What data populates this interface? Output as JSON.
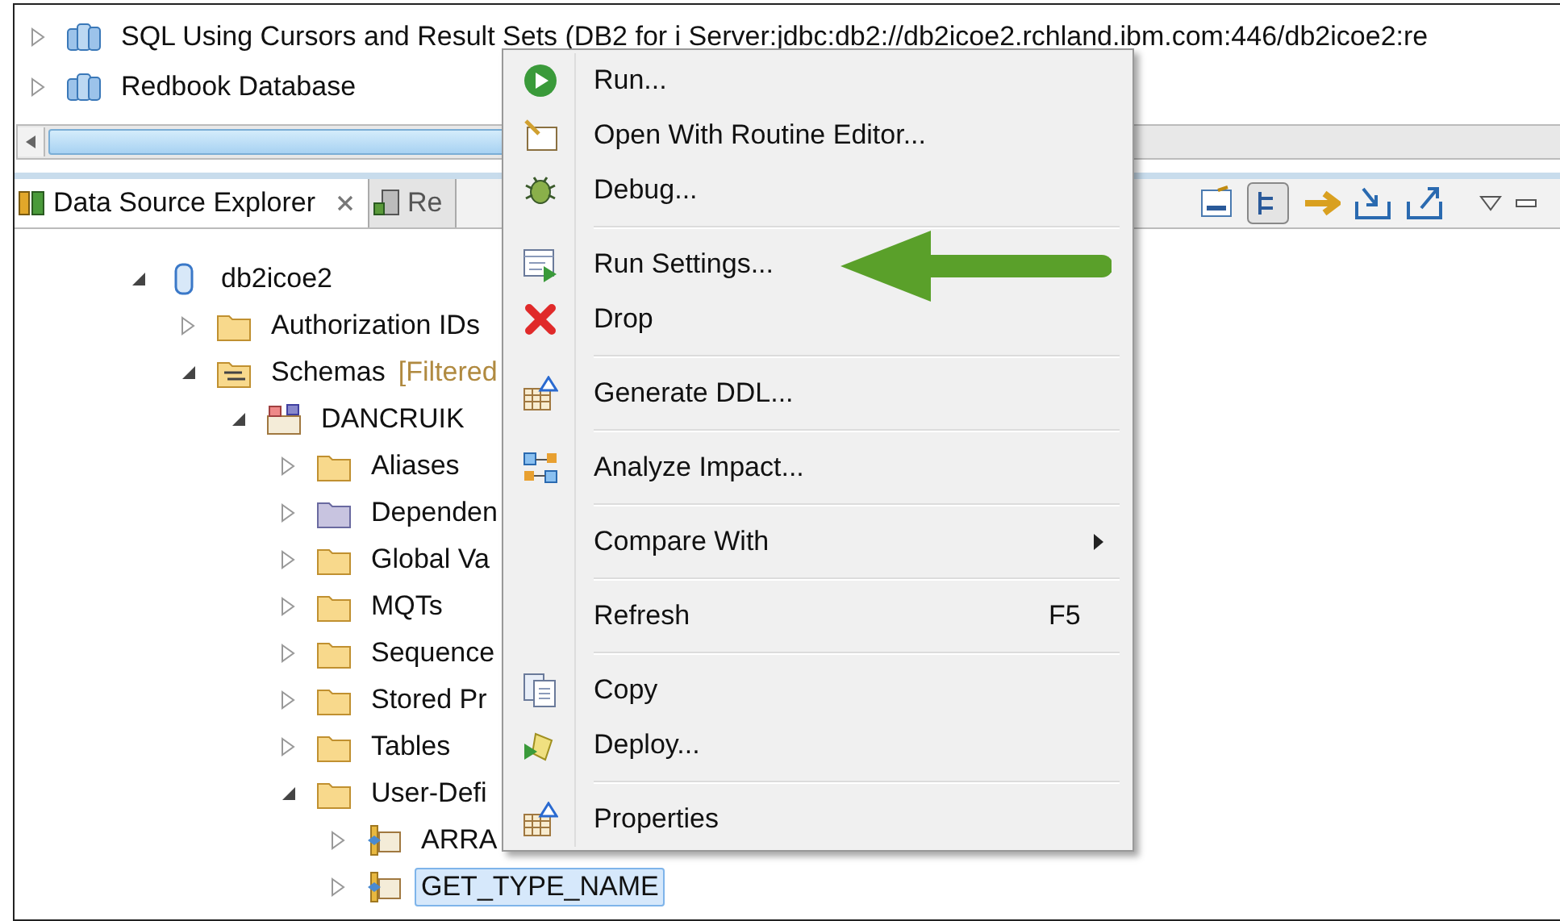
{
  "top_tree": [
    {
      "kind": "database-group",
      "label": "SQL Using Cursors and Result Sets (DB2 for i Server:jdbc:db2://db2icoe2.rchland.ibm.com:446/db2icoe2:re",
      "expanded": false
    },
    {
      "kind": "database-group",
      "label": "Redbook Database",
      "expanded": false
    }
  ],
  "tabs": [
    {
      "label": "Data Source Explorer",
      "selected": true,
      "closable": true
    },
    {
      "label": "Re",
      "selected": false,
      "closable": false
    }
  ],
  "tree": [
    {
      "kind": "database",
      "label": "db2icoe2",
      "expanded": true,
      "selected": false,
      "children": [
        {
          "kind": "folder",
          "label": "Authorization IDs",
          "expanded": false,
          "selected": false
        },
        {
          "kind": "schemas",
          "label": "Schemas",
          "note": "[Filtered",
          "expanded": true,
          "selected": false,
          "children": [
            {
              "kind": "schema",
              "label": "DANCRUIK",
              "expanded": true,
              "selected": false,
              "children": [
                {
                  "kind": "folder",
                  "label": "Aliases",
                  "expanded": false,
                  "selected": false
                },
                {
                  "kind": "dependency-folder",
                  "label": "Dependen",
                  "expanded": false,
                  "selected": false
                },
                {
                  "kind": "folder",
                  "label": "Global Va",
                  "expanded": false,
                  "selected": false
                },
                {
                  "kind": "folder",
                  "label": "MQTs",
                  "expanded": false,
                  "selected": false
                },
                {
                  "kind": "folder",
                  "label": "Sequence",
                  "expanded": false,
                  "selected": false
                },
                {
                  "kind": "folder",
                  "label": "Stored Pr",
                  "expanded": false,
                  "selected": false
                },
                {
                  "kind": "folder",
                  "label": "Tables",
                  "expanded": false,
                  "selected": false
                },
                {
                  "kind": "folder",
                  "label": "User-Defi",
                  "expanded": true,
                  "selected": false,
                  "children": [
                    {
                      "kind": "type",
                      "label": "ARRA",
                      "expanded": false,
                      "selected": false
                    },
                    {
                      "kind": "type",
                      "label": "GET_TYPE_NAME",
                      "expanded": false,
                      "selected": true
                    }
                  ]
                }
              ]
            }
          ]
        }
      ]
    }
  ],
  "context_menu": {
    "groups": [
      [
        {
          "kind": "run",
          "label": "Run..."
        },
        {
          "kind": "editor",
          "label": "Open With Routine Editor..."
        },
        {
          "kind": "debug",
          "label": "Debug..."
        }
      ],
      [
        {
          "kind": "settings",
          "label": "Run Settings..."
        },
        {
          "kind": "drop",
          "label": "Drop"
        }
      ],
      [
        {
          "kind": "ddl",
          "label": "Generate DDL..."
        }
      ],
      [
        {
          "kind": "impact",
          "label": "Analyze Impact..."
        }
      ],
      [
        {
          "kind": "none",
          "label": "Compare With",
          "submenu": true
        }
      ],
      [
        {
          "kind": "none",
          "label": "Refresh",
          "shortcut": "F5"
        }
      ],
      [
        {
          "kind": "copy",
          "label": "Copy"
        },
        {
          "kind": "deploy",
          "label": "Deploy..."
        }
      ],
      [
        {
          "kind": "ddl",
          "label": "Properties"
        }
      ]
    ]
  }
}
